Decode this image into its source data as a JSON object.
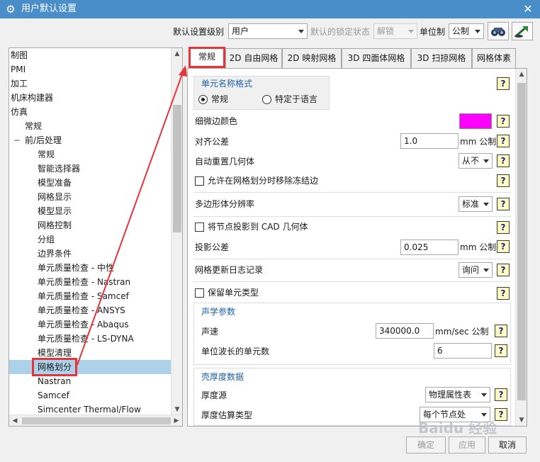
{
  "window": {
    "title": "用户默认设置",
    "close_label": "✕"
  },
  "topbar": {
    "level_label": "默认设置级别",
    "level_value": "用户",
    "lock_label": "默认的锁定状态",
    "lock_value": "解锁",
    "unit_label": "单位制",
    "unit_value": "公制"
  },
  "tree": {
    "items": [
      "制图",
      "PMI",
      "加工",
      "机床构建器",
      "仿真",
      "常规",
      "前/后处理",
      "常规",
      "智能选择器",
      "模型准备",
      "网格显示",
      "模型显示",
      "网格控制",
      "分组",
      "边界条件",
      "单元质量检查 - 中性",
      "单元质量检查 - Nastran",
      "单元质量检查 - Samcef",
      "单元质量检查 - ANSYS",
      "单元质量检查 - Abaqus",
      "单元质量检查 - LS-DYNA",
      "模型清理",
      "网格划分",
      "Nastran",
      "Samcef",
      "Simcenter Thermal/Flow"
    ],
    "expander_minus": "−"
  },
  "tabs": [
    "常规",
    "2D 自由网格",
    "2D 映射网格",
    "3D 四面体网格",
    "3D 扫掠网格",
    "网格体素"
  ],
  "general": {
    "element_name_group_title": "单元名称格式",
    "radio_general": "常规",
    "radio_lang": "特定于语言",
    "fine_edge_color_label": "细微边颜色",
    "align_tol_label": "对齐公差",
    "align_tol_value": "1.0",
    "align_tol_unit": "mm 公制",
    "auto_reset_label": "自动重置几何体",
    "auto_reset_value": "从不",
    "allow_remove_label": "允许在网格划分时移除冻结边",
    "polygon_res_label": "多边形体分辨率",
    "polygon_res_value": "标准",
    "project_nodes_label": "将节点投影到 CAD 几何体",
    "project_tol_label": "投影公差",
    "project_tol_value": "0.025",
    "project_tol_unit": "mm 公制",
    "mesh_log_label": "网格更新日志记录",
    "mesh_log_value": "询问",
    "keep_type_label": "保留单元类型",
    "acoustic_title": "声学参数",
    "sound_speed_label": "声速",
    "sound_speed_value": "340000.0",
    "sound_speed_unit": "mm/sec 公制",
    "elem_per_wave_label": "单位波长的单元数",
    "elem_per_wave_value": "6",
    "shell_title": "壳厚度数据",
    "thickness_source_label": "厚度源",
    "thickness_source_value": "物理属性表",
    "thickness_est_label": "厚度估算类型",
    "thickness_est_value": "每个节点处"
  },
  "help_label": "?",
  "buttons": {
    "ok": "确定",
    "apply": "应用",
    "cancel": "取消"
  },
  "watermark": "Baidu 经验",
  "colors": {
    "title_bar": "#4a8ec9",
    "callout": "#e4343c",
    "fine_edge_color": "#ff00ff",
    "selection": "#add1e8",
    "group_title": "#1f5fa8"
  }
}
